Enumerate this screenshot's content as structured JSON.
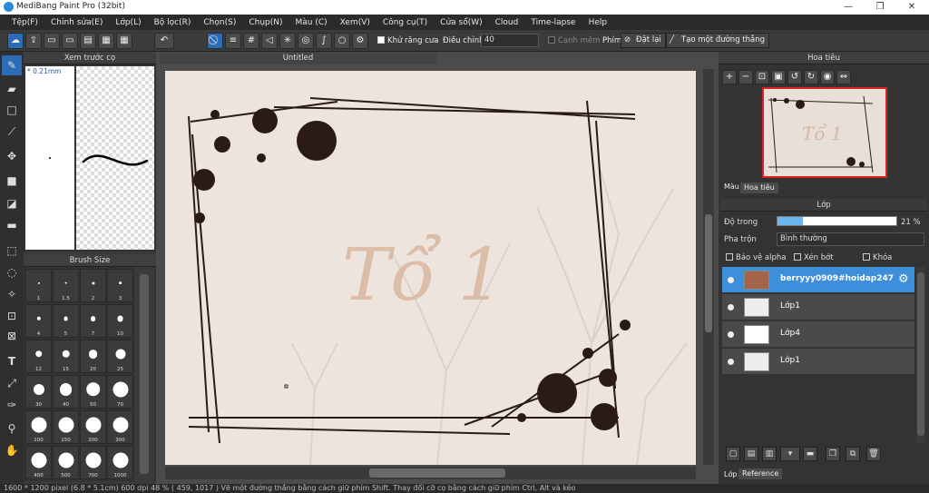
{
  "window": {
    "title": "MediBang Paint Pro (32bit)",
    "minimize": "—",
    "maximize": "❐",
    "close": "✕"
  },
  "menu": [
    "Tệp(F)",
    "Chỉnh sửa(E)",
    "Lớp(L)",
    "Bộ lọc(R)",
    "Chọn(S)",
    "Chụp(N)",
    "Màu (C)",
    "Xem(V)",
    "Công cụ(T)",
    "Cửa sổ(W)",
    "Cloud",
    "Time-lapse",
    "Help"
  ],
  "toolbar": {
    "antialias_label": "Khử răng cưa",
    "correction_label": "Điều chỉnh",
    "correction_value": "40",
    "edge_label": "Cạnh mềm",
    "key_label": "Phím",
    "reset_label": "Đặt lại",
    "line_label": "Tạo một đường thẳng"
  },
  "brush_preview": {
    "title": "Xem trước cọ",
    "size_text": "* 0.21mm"
  },
  "brush_size": {
    "title": "Brush Size",
    "sizes": [
      "1",
      "1.5",
      "2",
      "3",
      "4",
      "5",
      "7",
      "10",
      "12",
      "15",
      "20",
      "25",
      "30",
      "40",
      "50",
      "70",
      "100",
      "150",
      "200",
      "300",
      "400",
      "500",
      "700",
      "1000"
    ]
  },
  "document": {
    "tab_title": "Untitled",
    "canvas_text": "Tổ 1"
  },
  "navigator": {
    "title": "Hoa tiêu"
  },
  "right_tabs": {
    "color": "Màu",
    "navigator": "Hoa tiêu"
  },
  "layers": {
    "title": "Lớp",
    "opacity_label": "Độ trong",
    "opacity_value": "21 %",
    "opacity_fraction": 0.21,
    "blend_label": "Pha trộn",
    "blend_value": "Bình thường",
    "protect_alpha": "Bảo vệ alpha",
    "clipping": "Xén bớt",
    "lock": "Khóa",
    "items": [
      {
        "name": "berryyy0909#hoidap247",
        "active": true
      },
      {
        "name": "Lớp1",
        "active": false
      },
      {
        "name": "Lớp4",
        "active": false
      },
      {
        "name": "Lớp1",
        "active": false
      }
    ],
    "bottom_tabs": [
      "Lớp",
      "Reference"
    ]
  },
  "status": "1600 * 1200 pixel   (6.8 * 5.1cm)   600 dpi   48 %   ( 459, 1017 )   Vẽ một đường thẳng bằng cách giữ phím Shift. Thay đổi cỡ cọ bằng cách giữ phím Ctrl, Alt và kéo"
}
